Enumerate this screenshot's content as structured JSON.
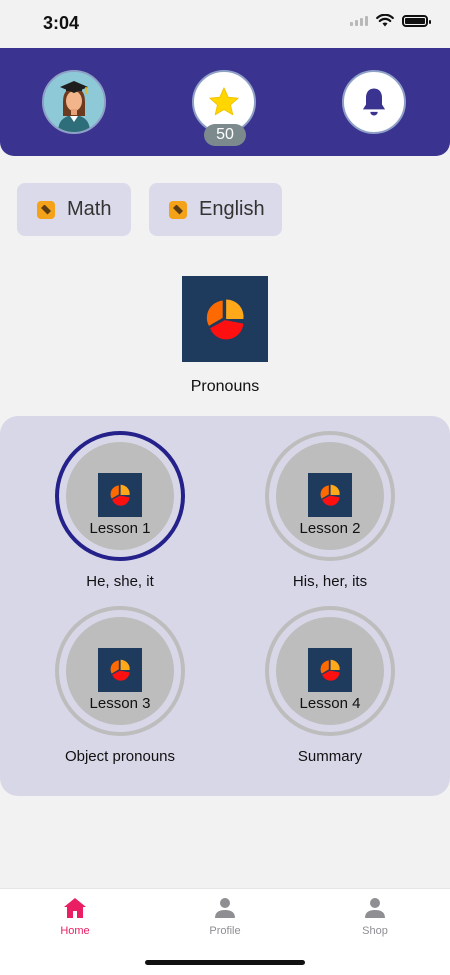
{
  "status_bar": {
    "time": "3:04"
  },
  "header": {
    "avatar_icon": "graduate-avatar-icon",
    "star_icon": "star-icon",
    "points": "50",
    "notification_icon": "bell-icon",
    "colors": {
      "header_bg": "#3a3390",
      "star": "#ffd600",
      "bell": "#3a3390"
    }
  },
  "subjects": [
    {
      "label": "Math",
      "icon": "dice-icon"
    },
    {
      "label": "English",
      "icon": "dice-icon"
    }
  ],
  "topic": {
    "title": "Pronouns",
    "icon": "pie-chart-icon"
  },
  "lessons": [
    {
      "label": "Lesson 1",
      "description": "He, she, it",
      "active": true
    },
    {
      "label": "Lesson 2",
      "description": "His, her, its",
      "active": false
    },
    {
      "label": "Lesson 3",
      "description": "Object pronouns",
      "active": false
    },
    {
      "label": "Lesson 4",
      "description": "Summary",
      "active": false
    }
  ],
  "tabs": [
    {
      "label": "Home",
      "icon": "home-icon",
      "active": true
    },
    {
      "label": "Profile",
      "icon": "person-icon",
      "active": false
    },
    {
      "label": "Shop",
      "icon": "person-icon",
      "active": false
    }
  ],
  "colors": {
    "accent": "#e91e63",
    "lesson_active_ring": "#24218a",
    "panel_bg": "#d8d7e8"
  }
}
